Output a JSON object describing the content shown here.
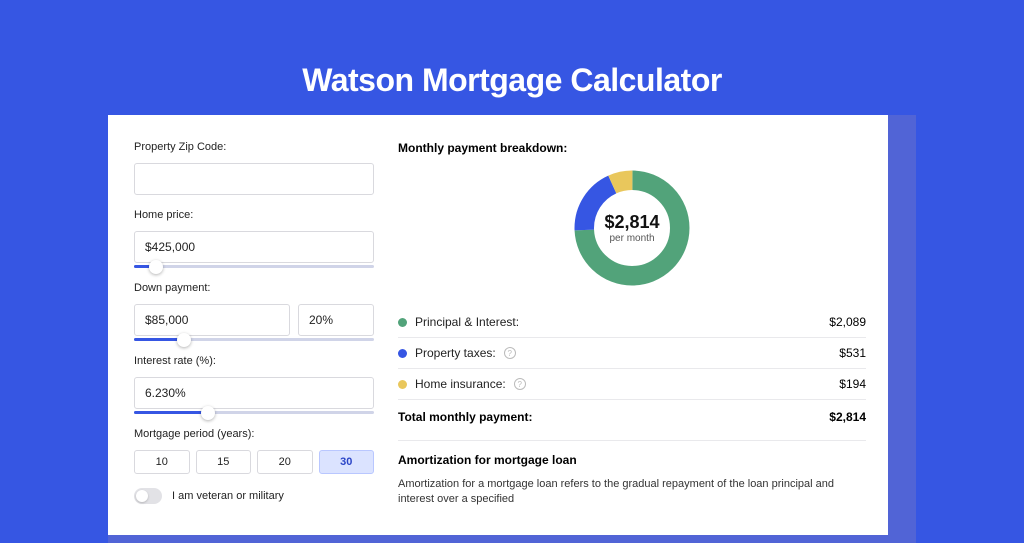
{
  "title": "Watson Mortgage Calculator",
  "colors": {
    "principal": "#52a37a",
    "taxes": "#3656e3",
    "insurance": "#e9c75c"
  },
  "form": {
    "zip": {
      "label": "Property Zip Code:",
      "value": ""
    },
    "home_price": {
      "label": "Home price:",
      "value": "$425,000",
      "slider_fill_pct": 9
    },
    "down_payment": {
      "label": "Down payment:",
      "amount": "$85,000",
      "percent": "20%",
      "slider_fill_pct": 21
    },
    "interest_rate": {
      "label": "Interest rate (%):",
      "value": "6.230%",
      "slider_fill_pct": 31
    },
    "period": {
      "label": "Mortgage period (years):",
      "options": [
        "10",
        "15",
        "20",
        "30"
      ],
      "selected": "30"
    },
    "veteran": {
      "label": "I am veteran or military",
      "on": false
    }
  },
  "breakdown": {
    "title": "Monthly payment breakdown:",
    "center_amount": "$2,814",
    "center_sub": "per month",
    "items": [
      {
        "label": "Principal & Interest:",
        "amount": "$2,089",
        "color": "principal",
        "has_help": false
      },
      {
        "label": "Property taxes:",
        "amount": "$531",
        "color": "taxes",
        "has_help": true
      },
      {
        "label": "Home insurance:",
        "amount": "$194",
        "color": "insurance",
        "has_help": true
      }
    ],
    "total_label": "Total monthly payment:",
    "total_amount": "$2,814"
  },
  "amortization": {
    "title": "Amortization for mortgage loan",
    "body": "Amortization for a mortgage loan refers to the gradual repayment of the loan principal and interest over a specified"
  },
  "chart_data": {
    "type": "pie",
    "title": "Monthly payment breakdown",
    "series": [
      {
        "name": "Principal & Interest",
        "value": 2089,
        "color": "#52a37a"
      },
      {
        "name": "Property taxes",
        "value": 531,
        "color": "#3656e3"
      },
      {
        "name": "Home insurance",
        "value": 194,
        "color": "#e9c75c"
      }
    ],
    "total": 2814,
    "center_label": "$2,814 per month"
  }
}
